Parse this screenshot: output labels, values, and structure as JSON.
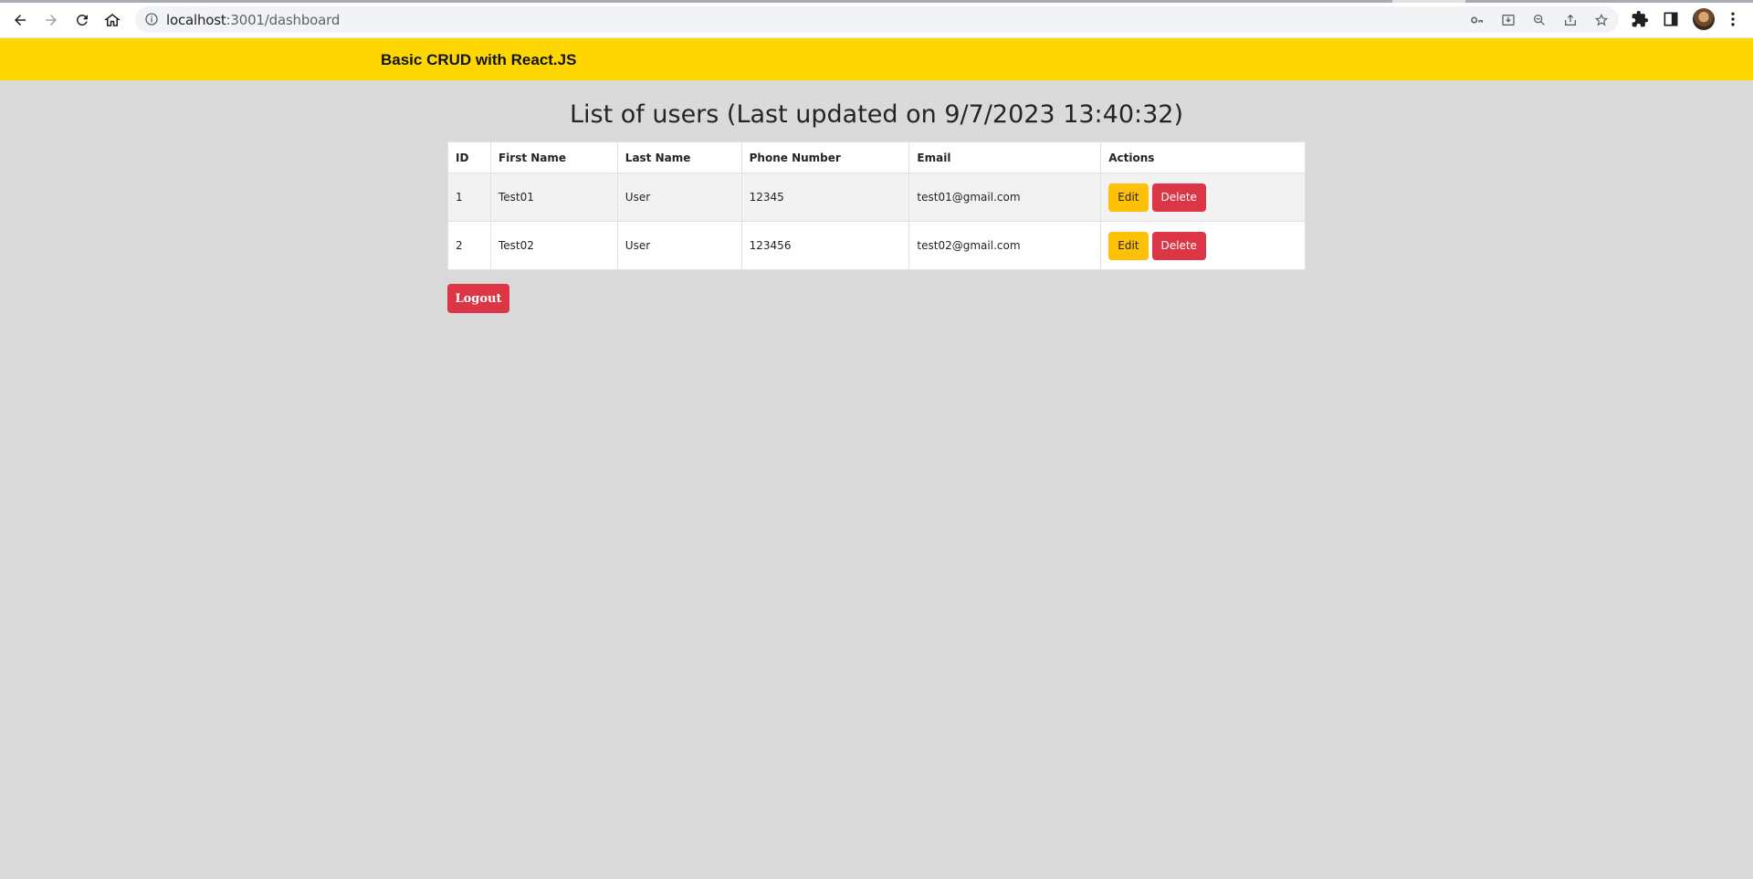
{
  "browser": {
    "url_host": "localhost",
    "url_path": ":3001/dashboard"
  },
  "header": {
    "title": "Basic CRUD with React.JS",
    "background": "#ffd700"
  },
  "page": {
    "heading": "List of users (Last updated on 9/7/2023 13:40:32)"
  },
  "table": {
    "columns": [
      "ID",
      "First Name",
      "Last Name",
      "Phone Number",
      "Email",
      "Actions"
    ],
    "rows": [
      {
        "id": "1",
        "first_name": "Test01",
        "last_name": "User",
        "phone": "12345",
        "email": "test01@gmail.com"
      },
      {
        "id": "2",
        "first_name": "Test02",
        "last_name": "User",
        "phone": "123456",
        "email": "test02@gmail.com"
      }
    ],
    "edit_label": "Edit",
    "delete_label": "Delete"
  },
  "logout_label": "Logout",
  "colors": {
    "edit": "#ffc107",
    "delete": "#dc3545",
    "page_bg": "#dadada"
  }
}
